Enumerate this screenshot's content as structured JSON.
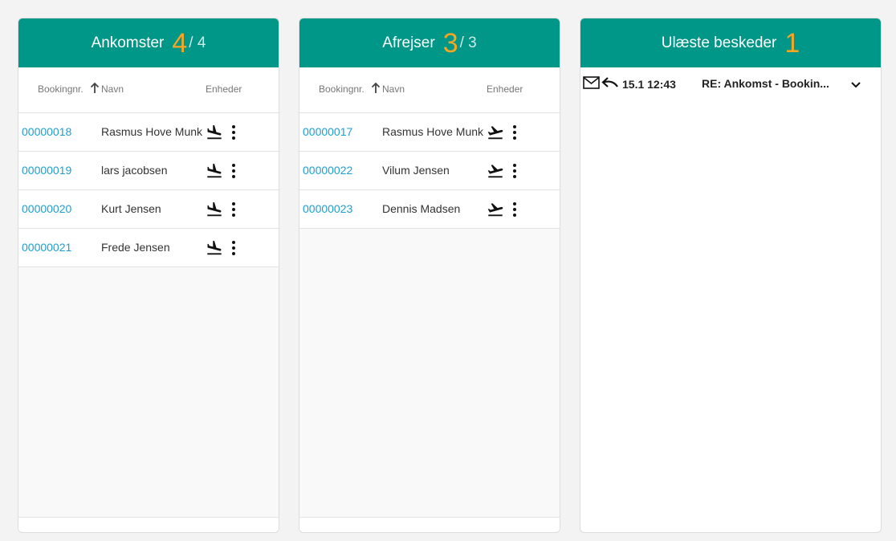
{
  "arrivals": {
    "title": "Ankomster",
    "count": "4",
    "total": "/ 4",
    "columns": {
      "booking": "Bookingnr.",
      "name": "Navn",
      "units": "Enheder"
    },
    "rows": [
      {
        "booking": "00000018",
        "name": "Rasmus Hove Munk"
      },
      {
        "booking": "00000019",
        "name": "lars jacobsen"
      },
      {
        "booking": "00000020",
        "name": "Kurt Jensen"
      },
      {
        "booking": "00000021",
        "name": "Frede Jensen"
      }
    ]
  },
  "departures": {
    "title": "Afrejser",
    "count": "3",
    "total": "/ 3",
    "columns": {
      "booking": "Bookingnr.",
      "name": "Navn",
      "units": "Enheder"
    },
    "rows": [
      {
        "booking": "00000017",
        "name": "Rasmus Hove Munk"
      },
      {
        "booking": "00000022",
        "name": "Vilum Jensen"
      },
      {
        "booking": "00000023",
        "name": "Dennis Madsen"
      }
    ]
  },
  "messages": {
    "title": "Ulæste beskeder",
    "count": "1",
    "items": [
      {
        "time": "15.1 12:43",
        "subject": "RE: Ankomst - Bookin..."
      }
    ]
  },
  "icons": {
    "arrival": "flight-land-icon",
    "departure": "flight-takeoff-icon",
    "more": "more-vert-icon",
    "sort": "arrow-up-icon",
    "mail": "mail-icon",
    "reply": "reply-icon",
    "expand": "chevron-down-icon"
  },
  "colors": {
    "header": "#009688",
    "count": "#f5a623",
    "link": "#1a9fd4"
  }
}
